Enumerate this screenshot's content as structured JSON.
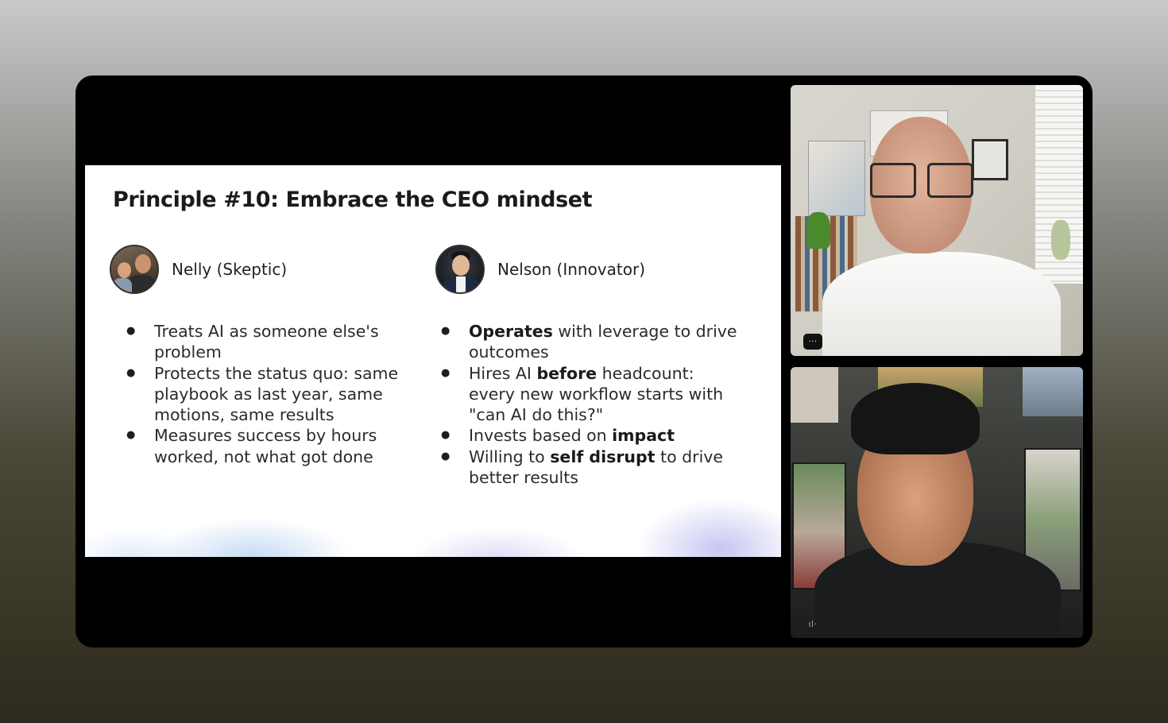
{
  "slide": {
    "title": "Principle #10: Embrace the CEO mindset",
    "personas": [
      {
        "name": "Nelly (Skeptic)",
        "bullets": [
          [
            "Treats AI as someone else's problem"
          ],
          [
            "Protects the status quo:  same playbook as last year, same motions, same results"
          ],
          [
            "Measures success by hours worked, not what got done"
          ]
        ]
      },
      {
        "name": "Nelson (Innovator)",
        "bullets": [
          [
            {
              "text": "Operates",
              "bold": true
            },
            " with leverage to drive outcomes"
          ],
          [
            "Hires AI ",
            {
              "text": "before",
              "bold": true
            },
            " headcount: every new workflow starts with \"can AI do this?\""
          ],
          [
            "Invests based on ",
            {
              "text": "impact",
              "bold": true
            }
          ],
          [
            "Willing to ",
            {
              "text": "self disrupt",
              "bold": true
            },
            " to drive better results"
          ]
        ]
      }
    ]
  },
  "participants": {
    "top": {
      "badge_icon": "more-options-icon",
      "badge_text": "···"
    },
    "bottom": {
      "badge_icon": "audio-level-icon",
      "badge_text": "ıl·"
    }
  },
  "colors": {
    "window_bg": "#000000",
    "slide_bg": "#ffffff",
    "slide_text": "#2b2b2b"
  }
}
